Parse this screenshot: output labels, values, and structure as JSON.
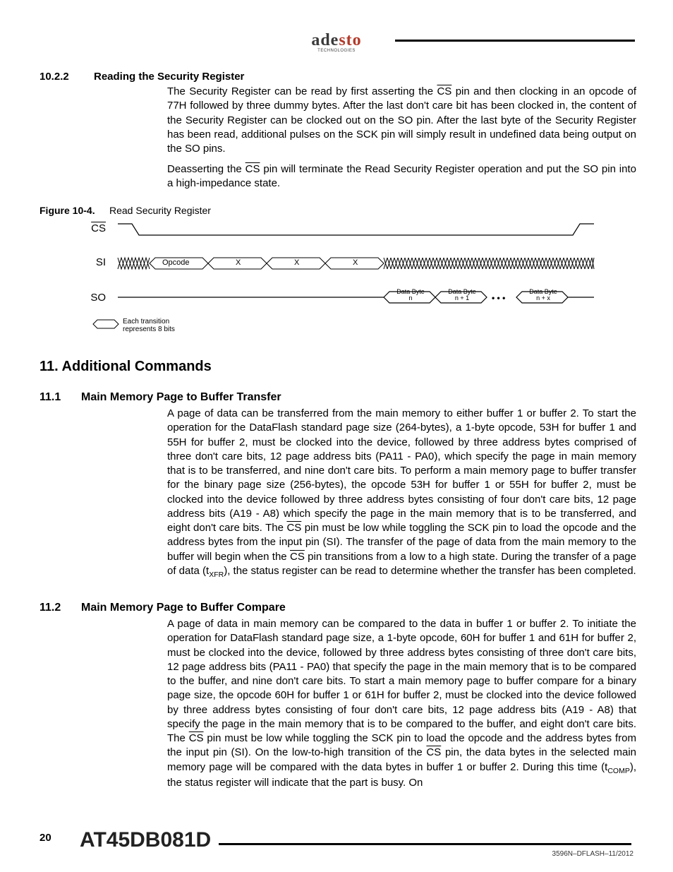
{
  "logo": {
    "part1": "ade",
    "part2": "sto",
    "sub": "TECHNOLOGIES"
  },
  "sec10_2_2": {
    "num": "10.2.2",
    "title": "Reading the Security Register",
    "p1a": "The Security Register can be read by first asserting the ",
    "p1cs": "CS",
    "p1b": " pin and then clocking in an opcode of 77H followed by three dummy bytes. After the last don't care bit has been clocked in, the content of the Security Register can be clocked out on the SO pin. After the last byte of the Security Register has been read, additional pulses on the SCK pin will simply result in undefined data being output on the SO pins.",
    "p2a": "Deasserting the ",
    "p2cs": "CS",
    "p2b": " pin will terminate the Read Security Register operation and put the SO pin into a high-impedance state."
  },
  "figure": {
    "label": "Figure 10-4.",
    "title": "Read Security Register",
    "cs": "CS",
    "si": "SI",
    "so": "SO",
    "opcode": "Opcode",
    "x": "X",
    "db_n_l1": "Data Byte",
    "db_n_l2": "n",
    "db_n1_l1": "Data Byte",
    "db_n1_l2": "n + 1",
    "db_nx_l1": "Data Byte",
    "db_nx_l2": "n + x",
    "dots": "• • •",
    "legend1": "Each transition",
    "legend2": "represents 8 bits"
  },
  "sec11": {
    "num": "11.",
    "title": "Additional Commands"
  },
  "sec11_1": {
    "num": "11.1",
    "title": "Main Memory Page to Buffer Transfer",
    "p_a": "A page of data can be transferred from the main memory to either buffer 1 or buffer 2. To start the operation for the DataFlash standard page size (264-bytes), a 1-byte opcode, 53H for buffer 1 and 55H for buffer 2, must be clocked into the device, followed by three address bytes comprised of three don't care bits, 12 page address bits (PA11 - PA0), which specify the page in main memory that is to be transferred, and nine don't care bits. To perform a main memory page to buffer transfer for the binary page size (256-bytes), the opcode 53H for buffer 1 or 55H for buffer 2, must be clocked into the device followed by three address bytes consisting of four don't care bits, 12 page address bits (A19 - A8) which specify the page in the main memory that is to be transferred, and eight don't care bits. The ",
    "cs1": "CS",
    "p_b": " pin must be low while toggling the SCK pin to load the opcode and the address bytes from the input pin (SI). The transfer of the page of data from the main memory to the buffer will begin when the ",
    "cs2": "CS",
    "p_c": " pin transitions from a low to a high state. During the transfer of a page of data (t",
    "sub1": "XFR",
    "p_d": "), the status register can be read to determine whether the transfer has been completed."
  },
  "sec11_2": {
    "num": "11.2",
    "title": "Main Memory Page to Buffer Compare",
    "p_a": "A page of data in main memory can be compared to the data in buffer 1 or buffer 2. To initiate the operation for DataFlash standard page size, a 1-byte opcode, 60H for buffer 1 and 61H for buffer 2, must be clocked into the device, followed by three address bytes consisting of three don't care bits, 12 page address bits (PA11 - PA0) that specify the page in the main memory that is to be compared to the buffer, and nine don't care bits. To start a main memory page to buffer compare for a binary page size, the opcode 60H for buffer 1 or 61H for buffer 2, must be clocked into the device followed by three address bytes consisting of four don't care bits, 12 page address bits (A19 - A8) that specify the page in the main memory that is to be compared to the buffer, and eight don't care bits. The ",
    "cs1": "CS",
    "p_b": " pin must be low while toggling the SCK pin to load the opcode and the address bytes from the input pin (SI). On the low-to-high transition of the ",
    "cs2": "CS",
    "p_c": " pin, the data bytes in the selected main memory page will be compared with the data bytes in buffer 1 or buffer 2. During this time (t",
    "sub1": "COMP",
    "p_d": "), the status register will indicate that the part is busy. On"
  },
  "footer": {
    "page": "20",
    "part": "AT45DB081D",
    "docid": "3596N–DFLASH–11/2012"
  }
}
